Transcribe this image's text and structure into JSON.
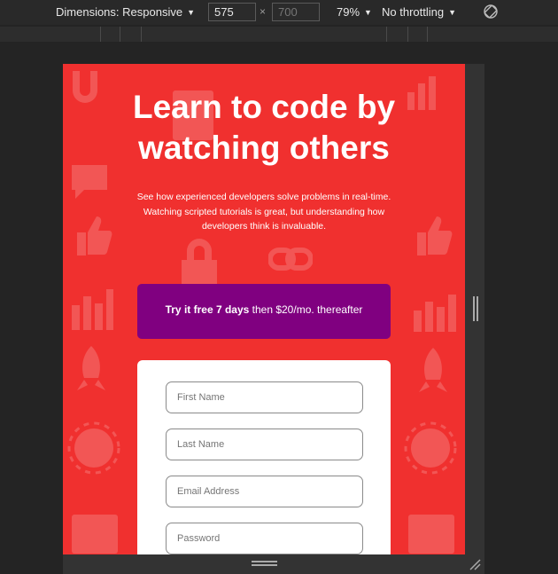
{
  "devtools": {
    "dimensions_label": "Dimensions: Responsive",
    "width_value": "575",
    "height_placeholder": "700",
    "times": "×",
    "zoom": "79%",
    "throttle": "No throttling",
    "caret": "▼"
  },
  "page": {
    "title_line1": "Learn to code by",
    "title_line2": "watching others",
    "subtitle": "See how experienced developers solve problems in real-time. Watching scripted tutorials is great, but understanding how developers think is invaluable.",
    "cta": {
      "bold": "Try it free 7 days",
      "rest": " then $20/mo. thereafter"
    },
    "form": {
      "first_name_placeholder": "First Name",
      "last_name_placeholder": "Last Name",
      "email_placeholder": "Email Address",
      "password_placeholder": "Password"
    }
  },
  "colors": {
    "background": "#f0302f",
    "cta": "#800080",
    "card": "#ffffff"
  }
}
